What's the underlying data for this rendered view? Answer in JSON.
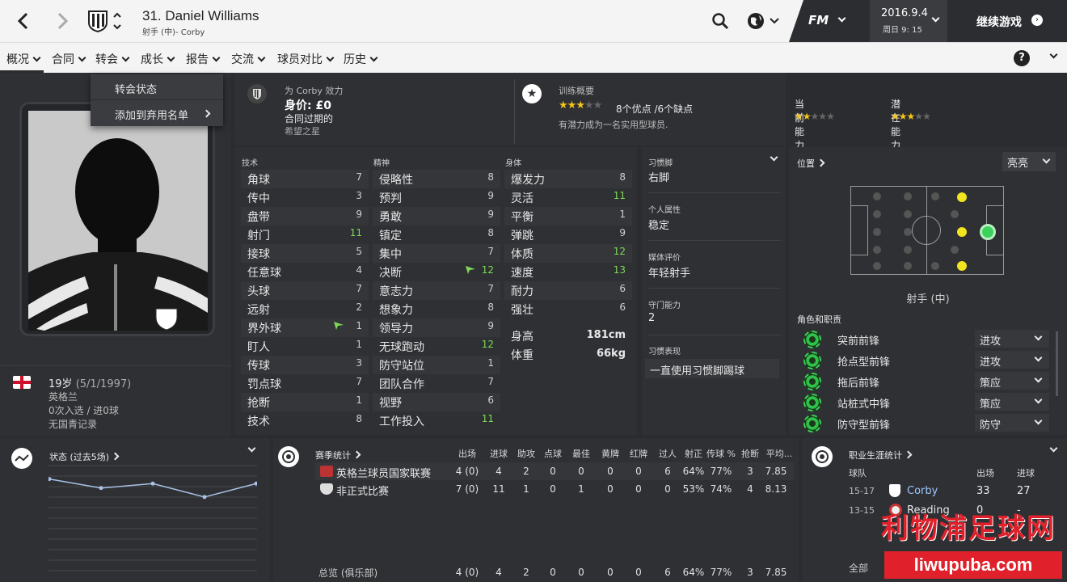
{
  "header": {
    "player_name": "31. Daniel Williams",
    "player_sub": "射手 (中)- Corby",
    "brand": "FM",
    "date": "2016.9.4",
    "day_time": "周日 9: 15",
    "continue_label": "继续游戏"
  },
  "nav": {
    "tabs": [
      "概况",
      "合同",
      "转会",
      "成长",
      "报告",
      "交流",
      "球员对比",
      "历史"
    ]
  },
  "dropdown": {
    "items": [
      "转会状态",
      "添加到弃用名单"
    ]
  },
  "club_info": {
    "plays_for": "为 Corby 效力",
    "value": "身价: £0",
    "contract": "合同过期的",
    "tag": "希望之星"
  },
  "training": {
    "title": "训练概要",
    "summary": "8个优点 /6个缺点",
    "note": "有潜力成为一名实用型球员.",
    "stars_filled": 3,
    "stars_total": 5
  },
  "ability": {
    "current_label": "当前能力",
    "potential_label": "潜在能力",
    "current_stars": 2,
    "potential_stars": 3,
    "stars_total": 5
  },
  "attributes": {
    "technical_title": "技术",
    "mental_title": "精神",
    "physical_title": "身体",
    "technical": [
      {
        "name": "角球",
        "value": "7",
        "hi": false
      },
      {
        "name": "传中",
        "value": "3",
        "hi": false
      },
      {
        "name": "盘带",
        "value": "9",
        "hi": false
      },
      {
        "name": "射门",
        "value": "11",
        "hi": true
      },
      {
        "name": "接球",
        "value": "5",
        "hi": false
      },
      {
        "name": "任意球",
        "value": "4",
        "hi": false
      },
      {
        "name": "头球",
        "value": "7",
        "hi": false
      },
      {
        "name": "远射",
        "value": "2",
        "hi": false
      },
      {
        "name": "界外球",
        "value": "1",
        "hi": false,
        "flag": true
      },
      {
        "name": "盯人",
        "value": "1",
        "hi": false
      },
      {
        "name": "传球",
        "value": "3",
        "hi": false
      },
      {
        "name": "罚点球",
        "value": "7",
        "hi": false
      },
      {
        "name": "抢断",
        "value": "1",
        "hi": false
      },
      {
        "name": "技术",
        "value": "8",
        "hi": false
      }
    ],
    "mental": [
      {
        "name": "侵略性",
        "value": "8",
        "hi": false
      },
      {
        "name": "预判",
        "value": "9",
        "hi": false
      },
      {
        "name": "勇敢",
        "value": "9",
        "hi": false
      },
      {
        "name": "镇定",
        "value": "8",
        "hi": false
      },
      {
        "name": "集中",
        "value": "7",
        "hi": false
      },
      {
        "name": "决断",
        "value": "12",
        "hi": true,
        "flag": true
      },
      {
        "name": "意志力",
        "value": "7",
        "hi": false
      },
      {
        "name": "想象力",
        "value": "8",
        "hi": false
      },
      {
        "name": "领导力",
        "value": "9",
        "hi": false
      },
      {
        "name": "无球跑动",
        "value": "12",
        "hi": true
      },
      {
        "name": "防守站位",
        "value": "1",
        "hi": false
      },
      {
        "name": "团队合作",
        "value": "7",
        "hi": false
      },
      {
        "name": "视野",
        "value": "6",
        "hi": false
      },
      {
        "name": "工作投入",
        "value": "11",
        "hi": true
      }
    ],
    "physical": [
      {
        "name": "爆发力",
        "value": "8",
        "hi": false
      },
      {
        "name": "灵活",
        "value": "11",
        "hi": true
      },
      {
        "name": "平衡",
        "value": "1",
        "hi": false
      },
      {
        "name": "弹跳",
        "value": "9",
        "hi": false
      },
      {
        "name": "体质",
        "value": "12",
        "hi": true
      },
      {
        "name": "速度",
        "value": "13",
        "hi": true
      },
      {
        "name": "耐力",
        "value": "6",
        "hi": false
      },
      {
        "name": "强壮",
        "value": "6",
        "hi": false
      }
    ],
    "height_label": "身高",
    "height": "181cm",
    "weight_label": "体重",
    "weight": "66kg"
  },
  "traits": {
    "foot_label": "习惯脚",
    "foot": "右脚",
    "personality_label": "个人属性",
    "personality": "稳定",
    "media_label": "媒体评价",
    "media": "年轻射手",
    "gk_label": "守门能力",
    "gk": "2",
    "habit_label": "习惯表现",
    "habit": "一直使用习惯脚踢球"
  },
  "position": {
    "title": "位置",
    "mode": "亮亮",
    "position_name": "射手 (中)",
    "roles_title": "角色和职责",
    "roles": [
      {
        "name": "突前前锋",
        "duty": "进攻"
      },
      {
        "name": "抢点型前锋",
        "duty": "进攻"
      },
      {
        "name": "拖后前锋",
        "duty": "策应"
      },
      {
        "name": "站桩式中锋",
        "duty": "策应"
      },
      {
        "name": "防守型前锋",
        "duty": "防守"
      }
    ]
  },
  "bio": {
    "age": "19岁",
    "dob": "(5/1/1997)",
    "nation": "英格兰",
    "caps": "0次入选 / 进0球",
    "youth": "无国青记录"
  },
  "form": {
    "title": "状态 (过去5场)",
    "values": [
      6.9,
      6.7,
      6.8,
      6.5,
      6.8
    ]
  },
  "season_stats": {
    "title": "赛季统计",
    "headers": [
      "出场",
      "进球",
      "助攻",
      "点球",
      "最佳",
      "黄牌",
      "红牌",
      "过人",
      "射正",
      "传球 %",
      "抢断",
      "平均..."
    ],
    "rows": [
      {
        "comp": "英格兰球员国家联赛",
        "cells": [
          "4 (0)",
          "4",
          "2",
          "0",
          "0",
          "0",
          "0",
          "6",
          "64%",
          "77%",
          "3",
          "7.85"
        ]
      },
      {
        "comp": "非正式比赛",
        "cells": [
          "7 (0)",
          "11",
          "1",
          "0",
          "1",
          "0",
          "0",
          "0",
          "53%",
          "74%",
          "4",
          "8.13"
        ]
      }
    ],
    "total_label": "总览 (俱乐部)",
    "total": [
      "4 (0)",
      "4",
      "2",
      "0",
      "0",
      "0",
      "0",
      "6",
      "64%",
      "77%",
      "3",
      "7.85"
    ]
  },
  "career": {
    "title": "职业生涯统计",
    "col_team": "球队",
    "col_apps": "出场",
    "col_goals": "进球",
    "rows": [
      {
        "season": "15-17",
        "team": "Corby",
        "apps": "33",
        "goals": "27"
      },
      {
        "season": "13-15",
        "team": "Reading",
        "apps": "0",
        "goals": "-"
      }
    ],
    "all_label": "全部"
  },
  "watermark": {
    "title": "利物浦足球网",
    "url": "liwupuba.com"
  },
  "colors": {
    "accent_green": "#7ed957",
    "star": "#f5c518",
    "bg": "#2a2c2f"
  }
}
